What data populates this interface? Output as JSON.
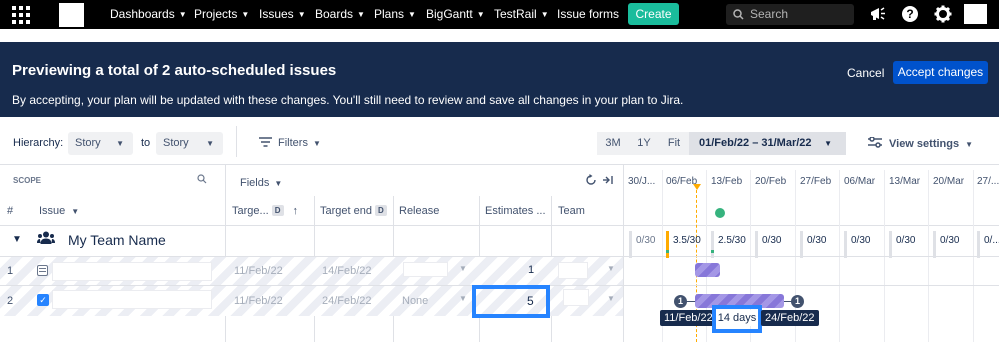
{
  "nav": {
    "items": [
      "Dashboards",
      "Projects",
      "Issues",
      "Boards",
      "Plans",
      "BigGantt",
      "TestRail",
      "Issue forms"
    ],
    "create_label": "Create",
    "search_placeholder": "Search"
  },
  "banner": {
    "title": "Previewing a total of 2 auto-scheduled issues",
    "description": "By accepting, your plan will be updated with these changes. You'll still need to review and save all changes in your plan to Jira.",
    "cancel_label": "Cancel",
    "accept_label": "Accept changes"
  },
  "toolbar": {
    "hierarchy_label": "Hierarchy:",
    "from_value": "Story",
    "to_label": "to",
    "to_value": "Story",
    "filters_label": "Filters",
    "zoom_options": [
      "3M",
      "1Y",
      "Fit"
    ],
    "date_range": "01/Feb/22 – 31/Mar/22",
    "view_settings_label": "View settings"
  },
  "table": {
    "scope_label": "SCOPE",
    "fields_label": "Fields",
    "columns": {
      "hash": "#",
      "issue": "Issue",
      "target_start": "Targe...",
      "target_start_chip": "D",
      "target_end": "Target end",
      "target_end_chip": "D",
      "release": "Release",
      "estimates": "Estimates ...",
      "team": "Team"
    },
    "team_row": {
      "name": "My Team Name"
    },
    "rows": [
      {
        "num": "1",
        "target_start": "11/Feb/22",
        "target_end": "14/Feb/22",
        "release": "",
        "estimate": "1"
      },
      {
        "num": "2",
        "target_start": "11/Feb/22",
        "target_end": "24/Feb/22",
        "release": "None",
        "estimate": "5"
      }
    ]
  },
  "timeline": {
    "dates": [
      "30/J...",
      "06/Feb",
      "13/Feb",
      "20/Feb",
      "27/Feb",
      "06/Mar",
      "13/Mar",
      "20/Mar",
      "27/..."
    ],
    "capacity": [
      "0/30",
      "3.5/30",
      "2.5/30",
      "0/30",
      "0/30",
      "0/30",
      "0/30",
      "0/30",
      "0/..."
    ],
    "bar_start_label": "11/Feb/22",
    "duration_label": "14 days",
    "bar_end_label": "24/Feb/22",
    "start_dot": "1",
    "end_dot": "1"
  },
  "colors": {
    "nav_bg": "#000000",
    "banner_bg": "#172b4d",
    "accent": "#0052cc",
    "create": "#1abc9c",
    "bar": "#8777d9",
    "highlight": "#2684ff",
    "release_marker": "#36b37e"
  }
}
